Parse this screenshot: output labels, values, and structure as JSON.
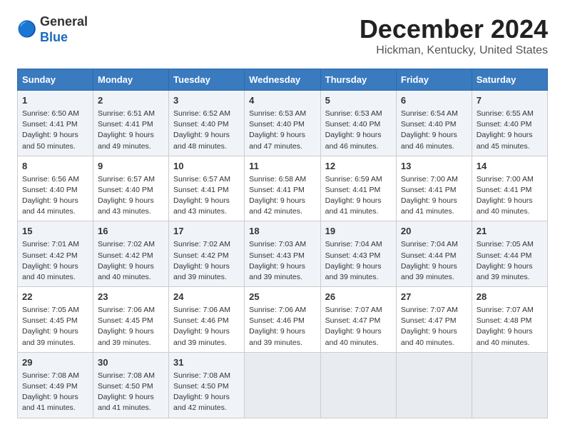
{
  "header": {
    "logo_line1": "General",
    "logo_line2": "Blue",
    "title": "December 2024",
    "subtitle": "Hickman, Kentucky, United States"
  },
  "weekdays": [
    "Sunday",
    "Monday",
    "Tuesday",
    "Wednesday",
    "Thursday",
    "Friday",
    "Saturday"
  ],
  "weeks": [
    [
      {
        "day": "1",
        "lines": [
          "Sunrise: 6:50 AM",
          "Sunset: 4:41 PM",
          "Daylight: 9 hours",
          "and 50 minutes."
        ]
      },
      {
        "day": "2",
        "lines": [
          "Sunrise: 6:51 AM",
          "Sunset: 4:41 PM",
          "Daylight: 9 hours",
          "and 49 minutes."
        ]
      },
      {
        "day": "3",
        "lines": [
          "Sunrise: 6:52 AM",
          "Sunset: 4:40 PM",
          "Daylight: 9 hours",
          "and 48 minutes."
        ]
      },
      {
        "day": "4",
        "lines": [
          "Sunrise: 6:53 AM",
          "Sunset: 4:40 PM",
          "Daylight: 9 hours",
          "and 47 minutes."
        ]
      },
      {
        "day": "5",
        "lines": [
          "Sunrise: 6:53 AM",
          "Sunset: 4:40 PM",
          "Daylight: 9 hours",
          "and 46 minutes."
        ]
      },
      {
        "day": "6",
        "lines": [
          "Sunrise: 6:54 AM",
          "Sunset: 4:40 PM",
          "Daylight: 9 hours",
          "and 46 minutes."
        ]
      },
      {
        "day": "7",
        "lines": [
          "Sunrise: 6:55 AM",
          "Sunset: 4:40 PM",
          "Daylight: 9 hours",
          "and 45 minutes."
        ]
      }
    ],
    [
      {
        "day": "8",
        "lines": [
          "Sunrise: 6:56 AM",
          "Sunset: 4:40 PM",
          "Daylight: 9 hours",
          "and 44 minutes."
        ]
      },
      {
        "day": "9",
        "lines": [
          "Sunrise: 6:57 AM",
          "Sunset: 4:40 PM",
          "Daylight: 9 hours",
          "and 43 minutes."
        ]
      },
      {
        "day": "10",
        "lines": [
          "Sunrise: 6:57 AM",
          "Sunset: 4:41 PM",
          "Daylight: 9 hours",
          "and 43 minutes."
        ]
      },
      {
        "day": "11",
        "lines": [
          "Sunrise: 6:58 AM",
          "Sunset: 4:41 PM",
          "Daylight: 9 hours",
          "and 42 minutes."
        ]
      },
      {
        "day": "12",
        "lines": [
          "Sunrise: 6:59 AM",
          "Sunset: 4:41 PM",
          "Daylight: 9 hours",
          "and 41 minutes."
        ]
      },
      {
        "day": "13",
        "lines": [
          "Sunrise: 7:00 AM",
          "Sunset: 4:41 PM",
          "Daylight: 9 hours",
          "and 41 minutes."
        ]
      },
      {
        "day": "14",
        "lines": [
          "Sunrise: 7:00 AM",
          "Sunset: 4:41 PM",
          "Daylight: 9 hours",
          "and 40 minutes."
        ]
      }
    ],
    [
      {
        "day": "15",
        "lines": [
          "Sunrise: 7:01 AM",
          "Sunset: 4:42 PM",
          "Daylight: 9 hours",
          "and 40 minutes."
        ]
      },
      {
        "day": "16",
        "lines": [
          "Sunrise: 7:02 AM",
          "Sunset: 4:42 PM",
          "Daylight: 9 hours",
          "and 40 minutes."
        ]
      },
      {
        "day": "17",
        "lines": [
          "Sunrise: 7:02 AM",
          "Sunset: 4:42 PM",
          "Daylight: 9 hours",
          "and 39 minutes."
        ]
      },
      {
        "day": "18",
        "lines": [
          "Sunrise: 7:03 AM",
          "Sunset: 4:43 PM",
          "Daylight: 9 hours",
          "and 39 minutes."
        ]
      },
      {
        "day": "19",
        "lines": [
          "Sunrise: 7:04 AM",
          "Sunset: 4:43 PM",
          "Daylight: 9 hours",
          "and 39 minutes."
        ]
      },
      {
        "day": "20",
        "lines": [
          "Sunrise: 7:04 AM",
          "Sunset: 4:44 PM",
          "Daylight: 9 hours",
          "and 39 minutes."
        ]
      },
      {
        "day": "21",
        "lines": [
          "Sunrise: 7:05 AM",
          "Sunset: 4:44 PM",
          "Daylight: 9 hours",
          "and 39 minutes."
        ]
      }
    ],
    [
      {
        "day": "22",
        "lines": [
          "Sunrise: 7:05 AM",
          "Sunset: 4:45 PM",
          "Daylight: 9 hours",
          "and 39 minutes."
        ]
      },
      {
        "day": "23",
        "lines": [
          "Sunrise: 7:06 AM",
          "Sunset: 4:45 PM",
          "Daylight: 9 hours",
          "and 39 minutes."
        ]
      },
      {
        "day": "24",
        "lines": [
          "Sunrise: 7:06 AM",
          "Sunset: 4:46 PM",
          "Daylight: 9 hours",
          "and 39 minutes."
        ]
      },
      {
        "day": "25",
        "lines": [
          "Sunrise: 7:06 AM",
          "Sunset: 4:46 PM",
          "Daylight: 9 hours",
          "and 39 minutes."
        ]
      },
      {
        "day": "26",
        "lines": [
          "Sunrise: 7:07 AM",
          "Sunset: 4:47 PM",
          "Daylight: 9 hours",
          "and 40 minutes."
        ]
      },
      {
        "day": "27",
        "lines": [
          "Sunrise: 7:07 AM",
          "Sunset: 4:47 PM",
          "Daylight: 9 hours",
          "and 40 minutes."
        ]
      },
      {
        "day": "28",
        "lines": [
          "Sunrise: 7:07 AM",
          "Sunset: 4:48 PM",
          "Daylight: 9 hours",
          "and 40 minutes."
        ]
      }
    ],
    [
      {
        "day": "29",
        "lines": [
          "Sunrise: 7:08 AM",
          "Sunset: 4:49 PM",
          "Daylight: 9 hours",
          "and 41 minutes."
        ]
      },
      {
        "day": "30",
        "lines": [
          "Sunrise: 7:08 AM",
          "Sunset: 4:50 PM",
          "Daylight: 9 hours",
          "and 41 minutes."
        ]
      },
      {
        "day": "31",
        "lines": [
          "Sunrise: 7:08 AM",
          "Sunset: 4:50 PM",
          "Daylight: 9 hours",
          "and 42 minutes."
        ]
      },
      null,
      null,
      null,
      null
    ]
  ]
}
